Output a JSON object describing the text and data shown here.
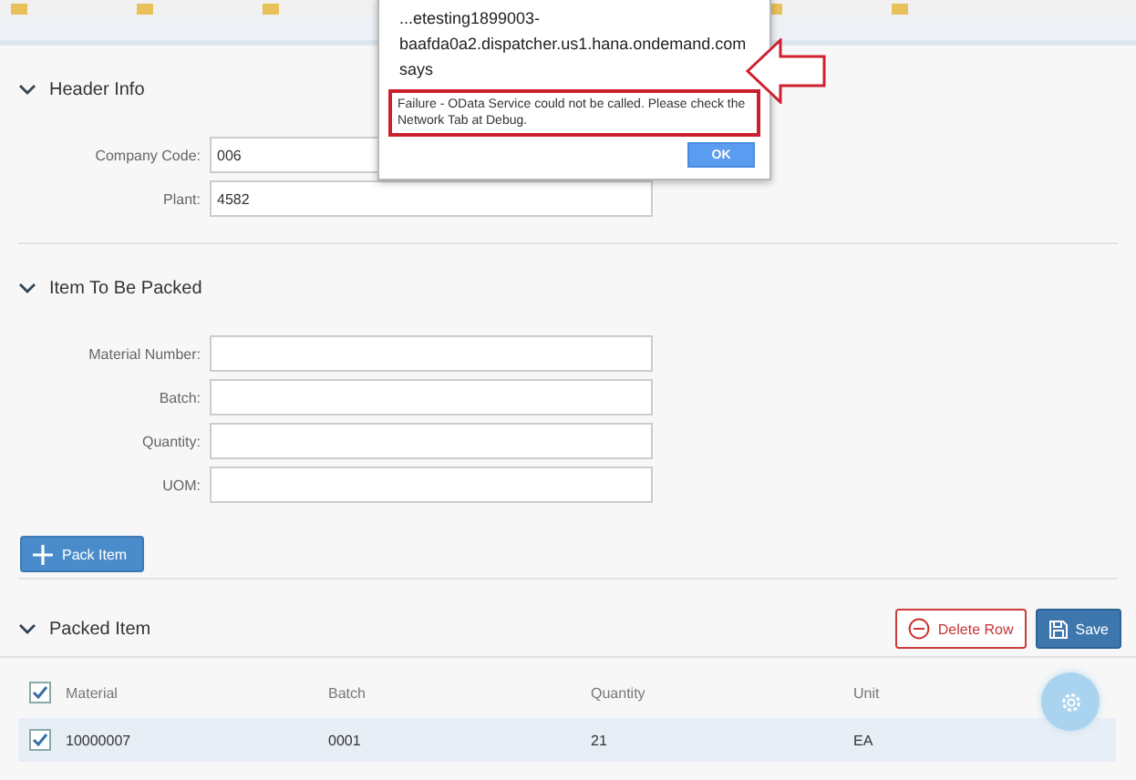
{
  "dialog": {
    "title": "...etesting1899003-baafda0a2.dispatcher.us1.hana.ondemand.com says",
    "message": "Failure - OData Service could not be called. Please check the Network Tab at Debug.",
    "button": "OK"
  },
  "sections": [
    {
      "title": "Header Info",
      "expanded": true,
      "fields": [
        {
          "label": "Company Code:",
          "value": "006"
        },
        {
          "label": "Plant:",
          "value": "4582"
        }
      ]
    },
    {
      "title": "Item To Be Packed",
      "expanded": true,
      "fields": [
        {
          "label": "Material Number:"
        },
        {
          "label": "Batch:"
        },
        {
          "label": "Quantity:"
        },
        {
          "label": "UOM:"
        }
      ],
      "button": "Pack Item"
    }
  ],
  "packed": {
    "title": "Packed Item",
    "expanded": true,
    "delete_button": "Delete Row",
    "save_button": "Save",
    "columns": [
      "Material",
      "Batch",
      "Quantity",
      "Unit"
    ],
    "header_checked": true,
    "rows": [
      {
        "checked": true,
        "cells": [
          "10000007",
          "0001",
          "21",
          "EA"
        ]
      }
    ]
  }
}
